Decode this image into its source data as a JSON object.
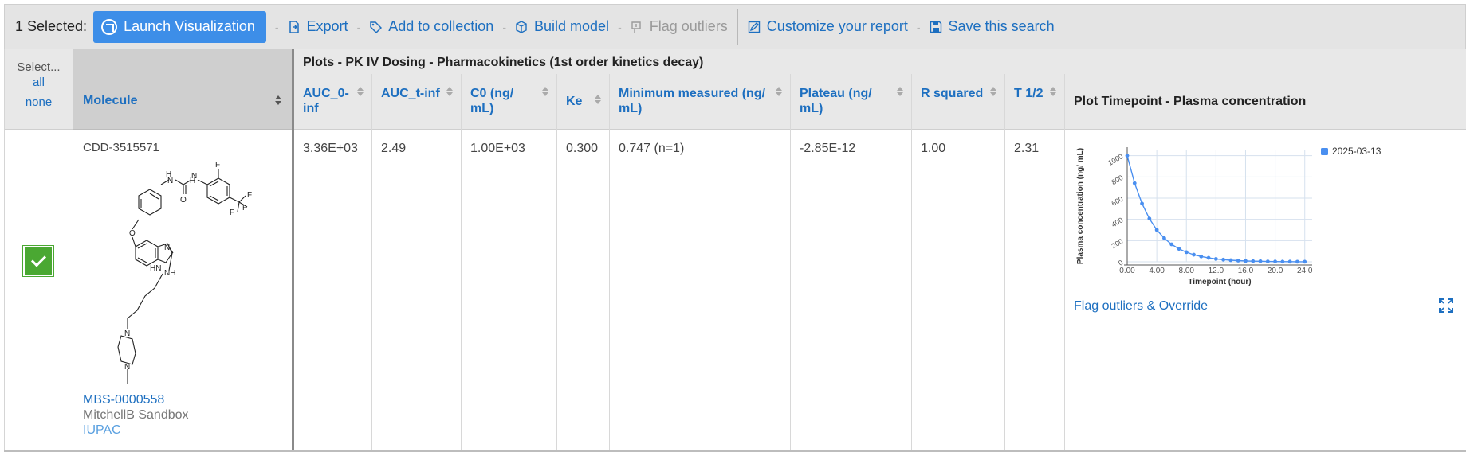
{
  "toolbar": {
    "selected_label": "1 Selected:",
    "launch_label": "Launch Visualization",
    "export_label": "Export",
    "add_collection_label": "Add to collection",
    "build_model_label": "Build model",
    "flag_outliers_label": "Flag outliers",
    "customize_label": "Customize your report",
    "save_search_label": "Save this search"
  },
  "select_col": {
    "header": "Select...",
    "all": "all",
    "none": "none",
    "checked": true
  },
  "molecule_col": {
    "header": "Molecule",
    "id": "CDD-3515571",
    "batch": "MBS-0000558",
    "project": "MitchellB Sandbox",
    "iupac": "IUPAC"
  },
  "plots": {
    "group_title": "Plots - PK IV Dosing - Pharmacokinetics (1st order kinetics decay)",
    "columns": [
      {
        "header": "AUC_0-inf",
        "value": "3.36E+03"
      },
      {
        "header": "AUC_t-inf",
        "value": "2.49"
      },
      {
        "header": "C0 (ng/ mL)",
        "value": "1.00E+03"
      },
      {
        "header": "Ke",
        "value": "0.300"
      },
      {
        "header": "Minimum measured (ng/ mL)",
        "value": "0.747 (n=1)"
      },
      {
        "header": "Plateau (ng/ mL)",
        "value": "-2.85E-12"
      },
      {
        "header": "R squared",
        "value": "1.00"
      },
      {
        "header": "T 1/2",
        "value": "2.31"
      }
    ],
    "plot_header": "Plot Timepoint - Plasma concentration",
    "flag_override_label": "Flag outliers & Override"
  },
  "chart_data": {
    "type": "line",
    "xlabel": "Timepoint (hour)",
    "ylabel": "Plasma concentration (ng/ mL)",
    "xlim": [
      0,
      25
    ],
    "ylim": [
      0,
      1050
    ],
    "x_ticks": [
      "0.00",
      "4.00",
      "8.00",
      "12.0",
      "16.0",
      "20.0",
      "24.0"
    ],
    "y_ticks": [
      "0",
      "200",
      "400",
      "600",
      "800",
      "1000"
    ],
    "legend": "top-right",
    "grid": true,
    "series": [
      {
        "name": "2025-03-13",
        "color": "#4a8ff0",
        "x": [
          0,
          1,
          2,
          3,
          4,
          5,
          6,
          7,
          8,
          9,
          10,
          11,
          12,
          13,
          14,
          15,
          16,
          17,
          18,
          19,
          20,
          21,
          22,
          23,
          24
        ],
        "y": [
          1000,
          741,
          549,
          407,
          301,
          223,
          165,
          122,
          91,
          67,
          50,
          37,
          27,
          20,
          15,
          11,
          8,
          6,
          5,
          3,
          2.5,
          1.8,
          1.4,
          1.0,
          0.75
        ]
      }
    ]
  }
}
